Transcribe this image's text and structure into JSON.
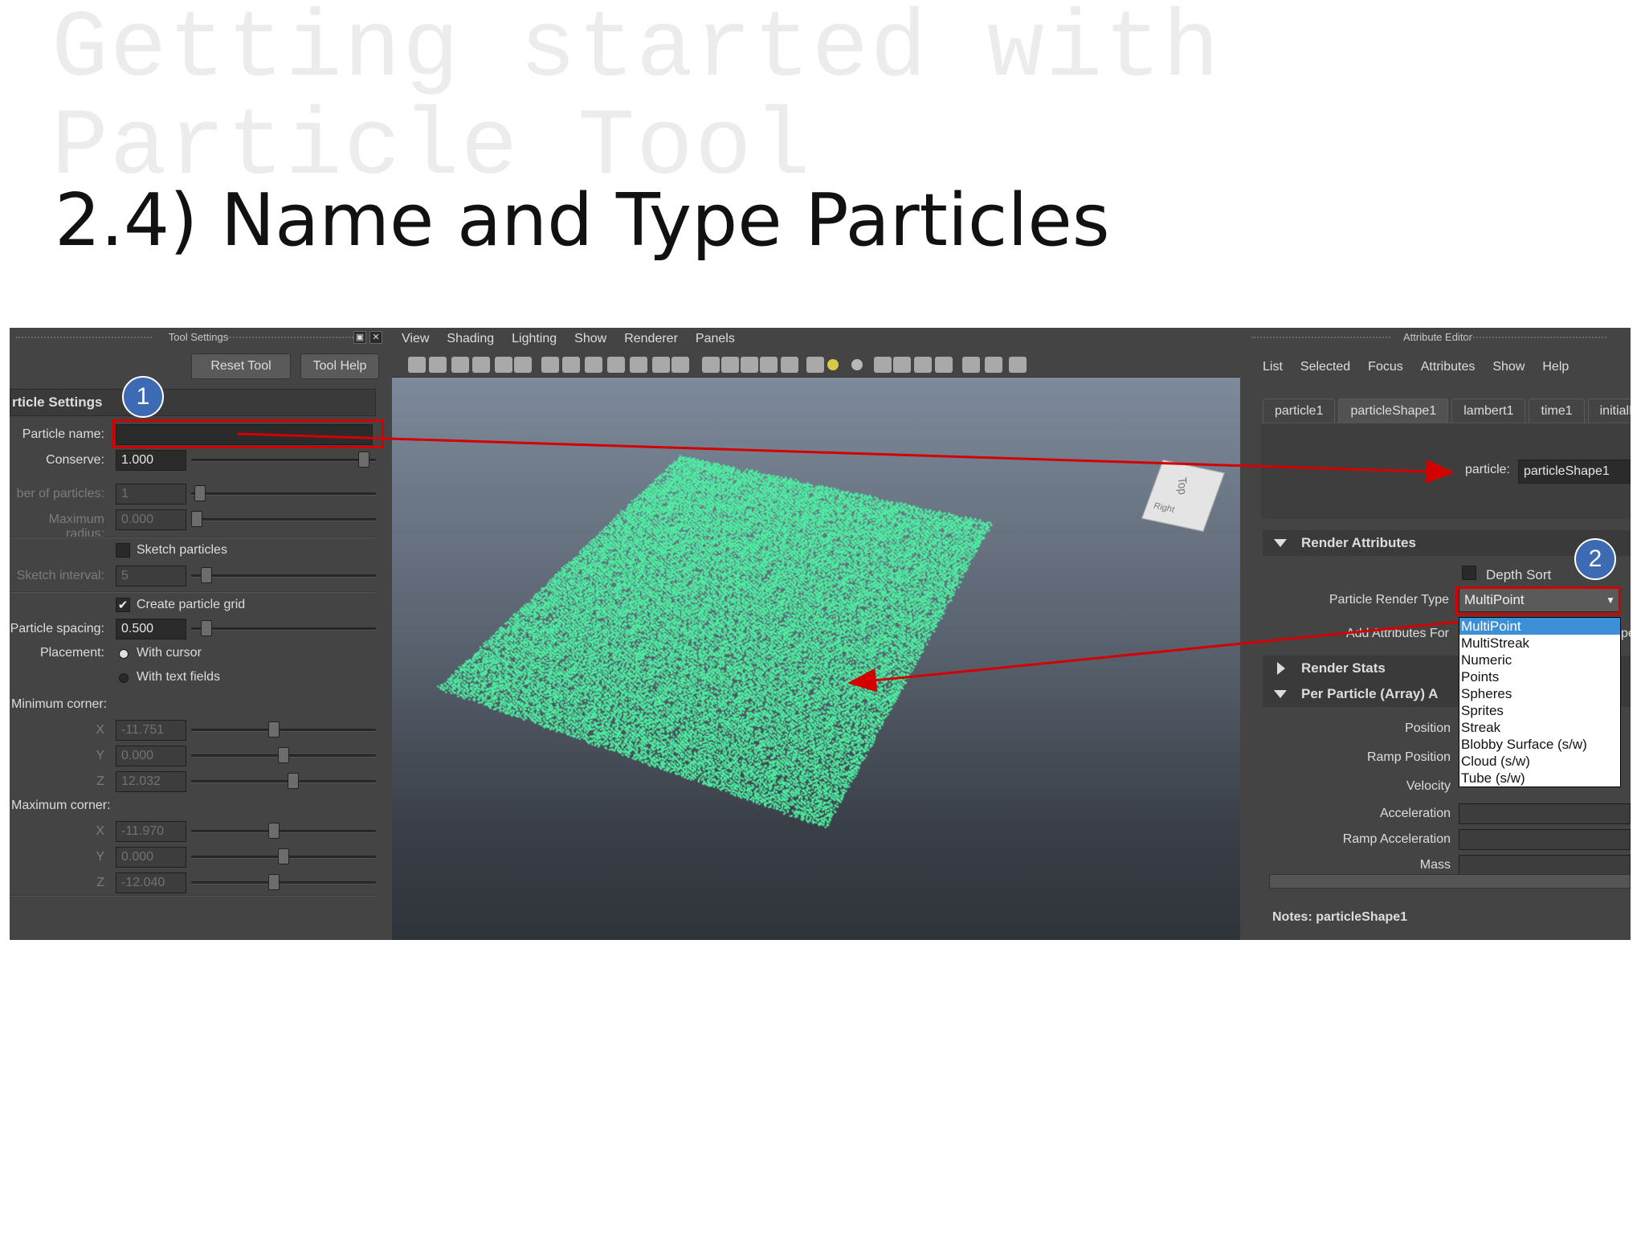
{
  "slide": {
    "ghost_title": "Getting started with Particle Tool",
    "main_title": "2.4) Name and Type Particles"
  },
  "tool_settings": {
    "title": "Tool Settings",
    "reset_label": "Reset Tool",
    "help_label": "Tool Help",
    "section_header": "rticle Settings",
    "particle_name_label": "Particle name:",
    "particle_name_value": "",
    "conserve_label": "Conserve:",
    "conserve_value": "1.000",
    "number_label": "ber of particles:",
    "number_value": "1",
    "max_radius_label": "Maximum radius:",
    "max_radius_value": "0.000",
    "sketch_particles_label": "Sketch particles",
    "sketch_interval_label": "Sketch interval:",
    "sketch_interval_value": "5",
    "create_grid_label": "Create particle grid",
    "spacing_label": "Particle spacing:",
    "spacing_value": "0.500",
    "placement_label": "Placement:",
    "with_cursor": "With cursor",
    "with_text_fields": "With text fields",
    "min_corner_label": "Minimum corner:",
    "min_x": "-11.751",
    "min_y": "0.000",
    "min_z": "12.032",
    "max_corner_label": "Maximum corner:",
    "max_x": "-11.970",
    "max_y": "0.000",
    "max_z": "-12.040",
    "x": "X",
    "y": "Y",
    "z": "Z"
  },
  "viewport": {
    "menu": [
      "View",
      "Shading",
      "Lighting",
      "Show",
      "Renderer",
      "Panels"
    ],
    "cube_top": "Top",
    "cube_right": "Right"
  },
  "attribute_editor": {
    "title": "Attribute Editor",
    "menu": [
      "List",
      "Selected",
      "Focus",
      "Attributes",
      "Show",
      "Help"
    ],
    "tabs": [
      "particle1",
      "particleShape1",
      "lambert1",
      "time1",
      "initialP"
    ],
    "particle_label": "particle:",
    "particle_value": "particleShape1",
    "render_attributes": "Render Attributes",
    "depth_sort": "Depth Sort",
    "render_type_label": "Particle Render Type",
    "render_type_value": "MultiPoint",
    "add_attributes_label": "Add Attributes For",
    "render_stats": "Render Stats",
    "per_particle": "Per Particle (Array) A",
    "position": "Position",
    "ramp_position": "Ramp Position",
    "velocity": "Velocity",
    "acceleration": "Acceleration",
    "ramp_acceleration": "Ramp Acceleration",
    "mass": "Mass",
    "notes": "Notes:  particleShape1",
    "options": [
      "MultiPoint",
      "MultiStreak",
      "Numeric",
      "Points",
      "Spheres",
      "Sprites",
      "Streak",
      "Blobby Surface (s/w)",
      "Cloud (s/w)",
      "Tube (s/w)"
    ],
    "options_edge": "pe"
  },
  "callouts": {
    "one": "1",
    "two": "2"
  },
  "colors": {
    "particles": "#4ef0a3",
    "accent_red": "#d40000",
    "badge": "#3d6bb3"
  }
}
